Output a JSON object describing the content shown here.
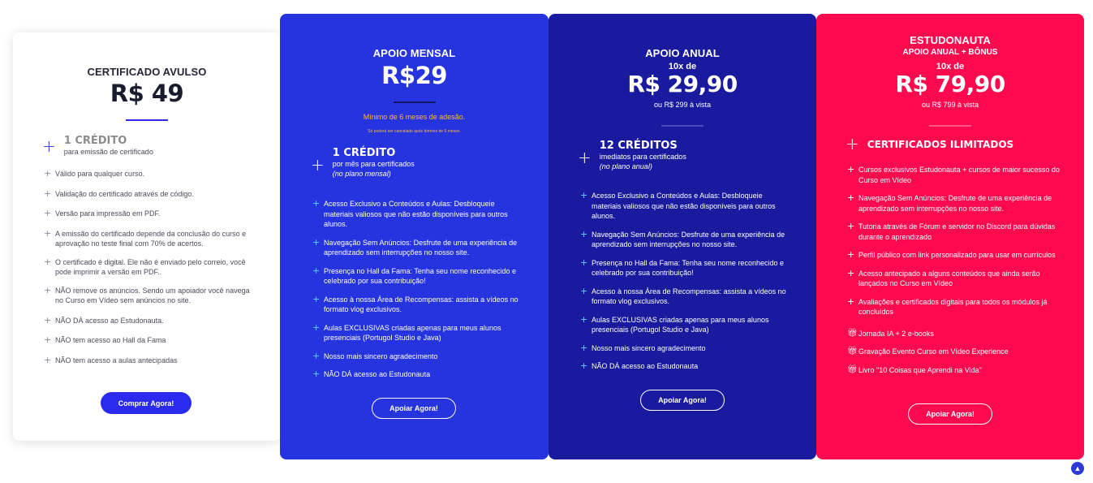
{
  "plans": {
    "avulso": {
      "title": "CERTIFICADO AVULSO",
      "price": "R$ 49",
      "credit_title": "1 CRÉDITO",
      "credit_sub": "para emissão de certificado",
      "features": [
        "Válido para qualquer curso.",
        "Validação do certificado através de código.",
        "Versão para impressão em PDF.",
        "A emissão do certificado depende da conclusão do curso e aprovação no teste final com 70% de acertos.",
        "O certificado é digital. Ele não é enviado pelo correio, você pode imprimir a versão em PDF..",
        "NÃO remove os anúncios. Sendo um apoiador você navega no Curso em Vídeo sem anúncios no site.",
        "NÃO DÁ acesso ao Estudonauta.",
        "NÃO tem acesso ao Hall da Fama",
        "NÃO tem acesso a aulas antecipadas"
      ],
      "button": "Comprar Agora!"
    },
    "mensal": {
      "title": "APOIO MENSAL",
      "price": "R$29",
      "minimum": "Mínimo de 6 meses de adesão.",
      "minimum_note": "Só poderá ser cancelado após término de 6 meses.",
      "credit_title": "1 CRÉDITO",
      "credit_sub": "por mês para certificados",
      "credit_note": "(no plano mensal)",
      "features": [
        "Acesso Exclusivo a Conteúdos e Aulas: Desbloqueie materiais valiosos que não estão disponíveis para outros alunos.",
        "Navegação Sem Anúncios: Desfrute de uma experiência de aprendizado sem interrupções no nosso site.",
        "Presença no Hall da Fama: Tenha seu nome reconhecido e celebrado por sua contribuição!",
        "Acesso à nossa Área de Recompensas: assista a vídeos no formato vlog exclusivos.",
        "Aulas EXCLUSIVAS criadas apenas para meus alunos presenciais (Portugol Studio e Java)",
        "Nosso mais sincero agradecimento",
        "NÃO DÁ acesso ao Estudonauta"
      ],
      "button": "Apoiar Agora!"
    },
    "anual": {
      "title": "APOIO ANUAL",
      "installments": "10x de",
      "price": "R$ 29,90",
      "cash": "ou R$ 299 à vista",
      "credit_title": "12 CRÉDITOS",
      "credit_sub": "imediatos para certificados",
      "credit_note": "(no plano anual)",
      "features": [
        "Acesso Exclusivo a Conteúdos e Aulas: Desbloqueie materiais valiosos que não estão disponíveis para outros alunos.",
        "Navegação Sem Anúncios: Desfrute de uma experiência de aprendizado sem interrupções no nosso site.",
        "Presença no Hall da Fama: Tenha seu nome reconhecido e celebrado por sua contribuição!",
        "Acesso à nossa Área de Recompensas: assista a vídeos no formato vlog exclusivos.",
        "Aulas EXCLUSIVAS criadas apenas para meus alunos presenciais (Portugol Studio e Java)",
        "Nosso mais sincero agradecimento",
        "NÃO DÁ acesso ao Estudonauta"
      ],
      "button": "Apoiar Agora!"
    },
    "estudonauta": {
      "title": "ESTUDONAUTA",
      "subtitle": "APOIO ANUAL + BÔNUS",
      "installments": "10x de",
      "price": "R$ 79,90",
      "cash": "ou R$ 799 à vista",
      "credit_title": "CERTIFICADOS ILIMITADOS",
      "features": [
        "Cursos exclusivos Estudonauta + cursos de maior sucesso do Curso em Vídeo",
        "Navegação Sem Anúncios: Desfrute de uma experiência de aprendizado sem interrupções no nosso site.",
        "Tutoria através de Fórum e servidor no Discord para dúvidas durante o aprendizado",
        "Perfil público com link personalizado para usar em currículos",
        "Acesso antecipado a alguns conteúdos que ainda serão lançados no Curso em Vídeo",
        "Avaliações e certificados digitais para todos os módulos já concluídos"
      ],
      "bonuses": [
        "Jornada IA + 2 e-books",
        "Gravação Evento Curso em Vídeo Experience",
        "Livro \"10 Coisas que Aprendi na Vida\""
      ],
      "button": "Apoiar Agora!"
    }
  },
  "icons": {
    "feature": "plus-icon",
    "bonus": "gift-icon",
    "scroll": "chevron-up-icon"
  },
  "colors": {
    "mensal_bg": "#2534df",
    "anual_bg": "#1a1a9e",
    "estudonauta_bg": "#ff0a4f",
    "accent_blue": "#2b2bef",
    "accent_cyan": "#5fd4ff",
    "accent_orange": "#ffb347"
  }
}
